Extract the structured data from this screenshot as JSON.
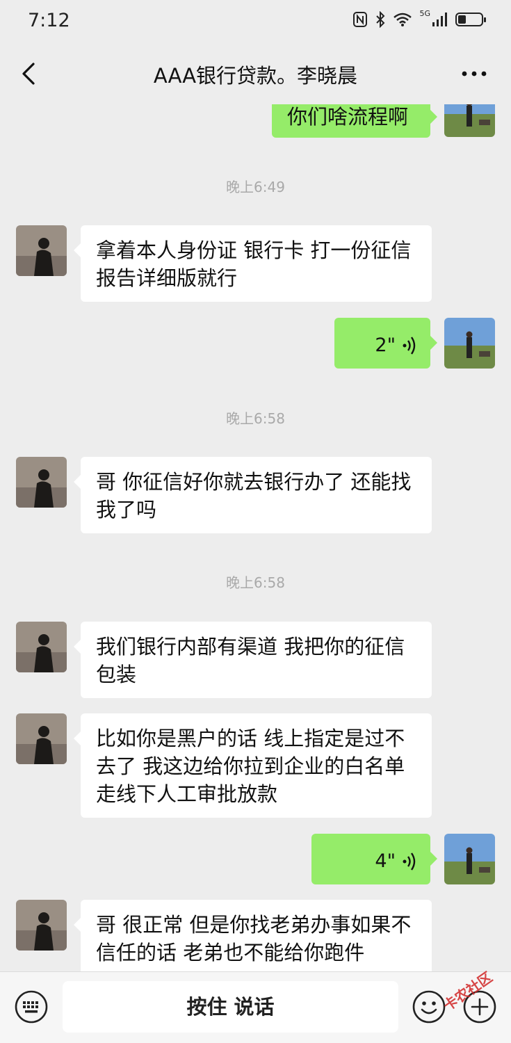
{
  "status_bar": {
    "time": "7:12",
    "signal_label": "5G",
    "battery_level": 0.35
  },
  "nav": {
    "title": "AAA银行贷款。李晓晨",
    "back_icon": "chevron-left-icon",
    "more_icon": "more-dots-icon"
  },
  "messages": [
    {
      "type": "text",
      "side": "out",
      "text": "你们啥流程啊"
    },
    {
      "type": "timestamp",
      "text": "晚上6:49"
    },
    {
      "type": "text",
      "side": "in",
      "lines": [
        "拿着本人身份证 银行卡 打一份征信",
        "报告详细版就行"
      ]
    },
    {
      "type": "voice",
      "side": "out",
      "duration": "2\""
    },
    {
      "type": "timestamp",
      "text": "晚上6:58"
    },
    {
      "type": "text",
      "side": "in",
      "lines": [
        "哥 你征信好你就去银行办了 还能找",
        "我了吗"
      ]
    },
    {
      "type": "timestamp",
      "text": "晚上6:58"
    },
    {
      "type": "text",
      "side": "in",
      "lines": [
        "我们银行内部有渠道 我把你的征信",
        "包装"
      ]
    },
    {
      "type": "text",
      "side": "in",
      "lines": [
        "比如你是黑户的话 线上指定是过不",
        "去了 我这边给你拉到企业的白名单",
        "走线下人工审批放款"
      ]
    },
    {
      "type": "voice",
      "side": "out",
      "duration": "4\""
    },
    {
      "type": "text",
      "side": "in",
      "lines": [
        "哥 很正常 但是你找老弟办事如果不",
        "信任的话 老弟也不能给你跑件"
      ]
    }
  ],
  "input_bar": {
    "talk_label": "按住 说话",
    "keyboard_icon": "keyboard-icon",
    "emoji_icon": "emoji-icon",
    "plus_icon": "plus-icon"
  },
  "watermark": "卡农社区",
  "colors": {
    "background": "#ededed",
    "outgoing_bubble": "#95ec69",
    "incoming_bubble": "#ffffff",
    "timestamp": "#a9a9a9"
  }
}
